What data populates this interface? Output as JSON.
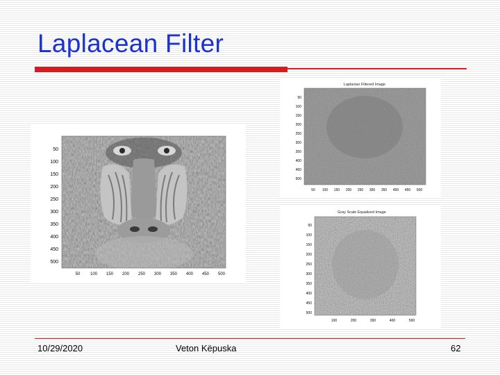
{
  "slide": {
    "title": "Laplacean Filter",
    "footer": {
      "date": "10/29/2020",
      "author": "Veton Këpuska",
      "page": "62"
    }
  },
  "figures": {
    "original": {
      "y_ticks": [
        "50",
        "100",
        "150",
        "200",
        "250",
        "300",
        "350",
        "400",
        "450",
        "500"
      ],
      "x_ticks": [
        "50",
        "100",
        "150",
        "200",
        "250",
        "300",
        "350",
        "400",
        "450",
        "500"
      ]
    },
    "laplacian": {
      "title": "Laplacian Filtered Image",
      "y_ticks": [
        "50",
        "100",
        "150",
        "200",
        "250",
        "300",
        "350",
        "400",
        "450",
        "500"
      ],
      "x_ticks": [
        "50",
        "100",
        "150",
        "200",
        "250",
        "300",
        "350",
        "400",
        "450",
        "500"
      ]
    },
    "equalized": {
      "title": "Gray Scale Equalized Image",
      "y_ticks": [
        "50",
        "100",
        "150",
        "200",
        "250",
        "300",
        "350",
        "400",
        "450",
        "500"
      ],
      "x_ticks": [
        "100",
        "200",
        "300",
        "400",
        "500"
      ]
    }
  },
  "colors": {
    "title": "#1a33cc",
    "accent": "#d21e1e"
  }
}
